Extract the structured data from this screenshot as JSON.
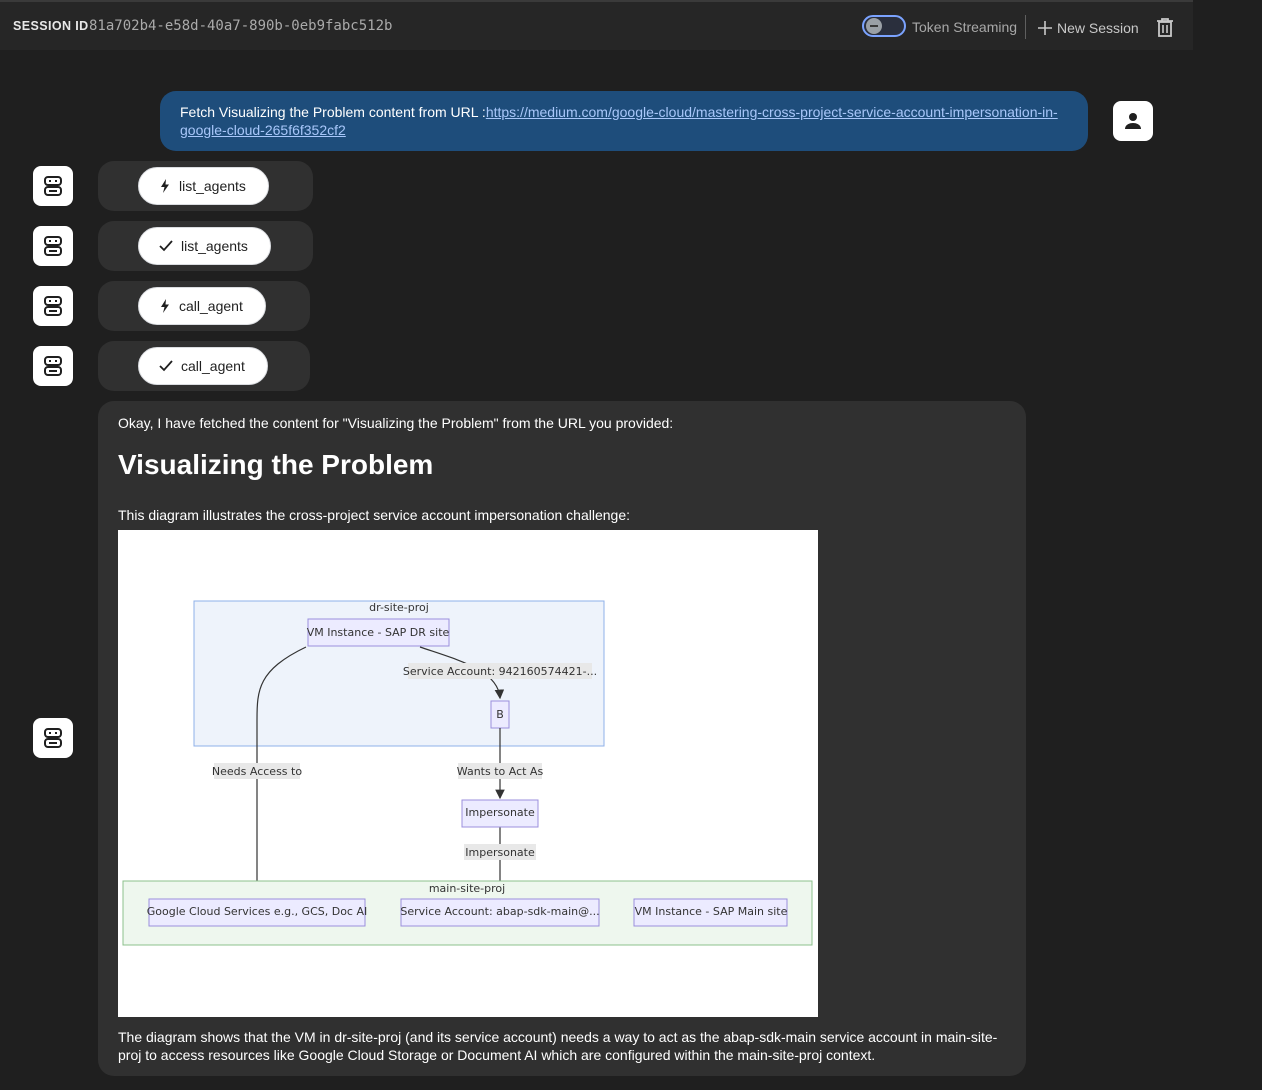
{
  "header": {
    "session_label": "SESSION ID",
    "session_id": "81a702b4-e58d-40a7-890b-0eb9fabc512b",
    "token_streaming_label": "Token Streaming",
    "token_streaming_on": false,
    "new_session_label": "New Session"
  },
  "user_message": {
    "text": "Fetch Visualizing the Problem content from URL :",
    "link": "https://medium.com/google-cloud/mastering-cross-project-service-account-impersonation-in-google-cloud-265f6f352cf2"
  },
  "tool_events": [
    {
      "icon": "bolt-icon",
      "label": "list_agents"
    },
    {
      "icon": "check-icon",
      "label": "list_agents"
    },
    {
      "icon": "bolt-icon",
      "label": "call_agent"
    },
    {
      "icon": "check-icon",
      "label": "call_agent"
    }
  ],
  "answer": {
    "intro": "Okay, I have fetched the content for \"Visualizing the Problem\" from the URL you provided:",
    "heading": "Visualizing the Problem",
    "caption": "This diagram illustrates the cross-project service account impersonation challenge:",
    "outro": "The diagram shows that the VM in dr-site-proj (and its service account) needs a way to act as the abap-sdk-main service account in main-site-proj to access resources like Google Cloud Storage or Document AI which are configured within the main-site-proj context."
  },
  "diagram": {
    "dr_group_label": "dr-site-proj",
    "dr_vm": "VM Instance - SAP DR site",
    "dr_sa_edge": "Service Account: 942160574421-...",
    "node_b": "B",
    "needs_access_edge": "Needs Access to",
    "wants_edge": "Wants to Act As",
    "impersonate_node": "Impersonate",
    "impersonate_edge": "Impersonate",
    "main_group_label": "main-site-proj",
    "gcs_node": "Google Cloud Services e.g., GCS, Doc AI",
    "main_sa_node": "Service Account: abap-sdk-main@...",
    "main_vm_node": "VM Instance - SAP Main site"
  },
  "colors": {
    "background": "#1f1f1f",
    "user_bubble": "#1e4d7b",
    "card": "#303030",
    "link": "#a8c7fa"
  }
}
